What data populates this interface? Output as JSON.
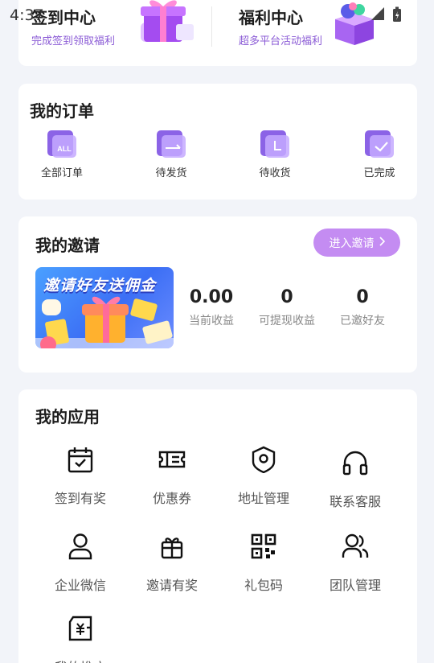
{
  "status_bar": {
    "time": "4:37"
  },
  "top": {
    "checkin": {
      "title": "签到中心",
      "subtitle": "完成签到领取福利"
    },
    "welfare": {
      "title": "福利中心",
      "subtitle": "超多平台活动福利"
    }
  },
  "orders": {
    "title": "我的订单",
    "items": [
      {
        "label": "全部订单",
        "icon": "all-orders-icon",
        "badge": "ALL"
      },
      {
        "label": "待发货",
        "icon": "to-ship-icon"
      },
      {
        "label": "待收货",
        "icon": "to-receive-icon"
      },
      {
        "label": "已完成",
        "icon": "completed-icon"
      }
    ]
  },
  "invite": {
    "title": "我的邀请",
    "button_label": "进入邀请",
    "banner_text": "邀请好友送佣金",
    "stats": [
      {
        "value": "0.00",
        "label": "当前收益"
      },
      {
        "value": "0",
        "label": "可提现收益"
      },
      {
        "value": "0",
        "label": "已邀好友"
      }
    ]
  },
  "apps": {
    "title": "我的应用",
    "items": [
      {
        "label": "签到有奖",
        "icon": "calendar-check-icon"
      },
      {
        "label": "优惠券",
        "icon": "coupon-icon"
      },
      {
        "label": "地址管理",
        "icon": "location-icon"
      },
      {
        "label": "联系客服",
        "icon": "headset-icon"
      },
      {
        "label": "企业微信",
        "icon": "person-icon"
      },
      {
        "label": "邀请有奖",
        "icon": "gift-icon"
      },
      {
        "label": "礼包码",
        "icon": "qrcode-icon"
      },
      {
        "label": "团队管理",
        "icon": "team-icon"
      },
      {
        "label": "我的推广",
        "icon": "promotion-icon"
      }
    ]
  },
  "colors": {
    "accent": "#8b5bd6",
    "invite_button": "#c48cf2",
    "icon_purple": "#7c5ce6"
  }
}
